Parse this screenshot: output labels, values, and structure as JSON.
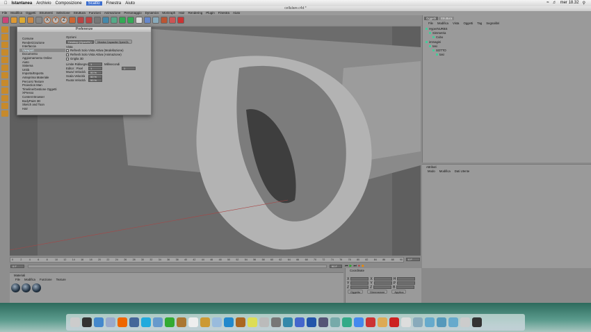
{
  "macmenu": {
    "apple": "apple-icon",
    "items": [
      "Istantanea",
      "Archivio",
      "Composizione",
      "Scatto",
      "Finestra",
      "Aiuto"
    ],
    "selected": "Scatto",
    "clock": "mer 18.32"
  },
  "window": {
    "title": "cellulare.c4d *"
  },
  "app_menu": [
    "File",
    "Modifica",
    "Oggetti",
    "Strumenti",
    "Selezione",
    "Struttura",
    "Funzioni",
    "Animazione",
    "Personaggio",
    "Dynamics",
    "MoGraph",
    "Hair",
    "Rendering",
    "Plugin",
    "Finestra",
    "Aiuto"
  ],
  "toolbar": {
    "axis_labels": [
      "X",
      "Y",
      "Z"
    ]
  },
  "prefs": {
    "title": "Preferenze",
    "sidebar": [
      "Comune",
      "Renderizzazione",
      "Interfaccia",
      "Viewport",
      "Documento",
      "Aggiornamento Online",
      "Aiuto",
      "Sistema",
      "Unità",
      "Importa/Esporta",
      "Anteprima Materiale",
      "Percorsi Texture",
      "Proiection Man",
      "Timeline/Gestione Oggetti",
      "XPresso",
      "Content Browser",
      "BodyPaint 3D",
      "Sketch and Toon",
      "Hair"
    ],
    "selected": "Viewport",
    "opzioni_label": "Opzioni",
    "display_select": "Desktop (OpenGL)",
    "opengl_button": "Mostra Capacità OpenGL",
    "vista_label": "Vista",
    "checks": [
      "Refresh Solo Vista Attiva (Modellazione)",
      "Refresh Solo Vista Attiva (Animazione)",
      "Griglia 3D"
    ],
    "fields": [
      {
        "label": "Limite Ridisegno",
        "value": "1",
        "unit": "Millisecondi"
      },
      {
        "label": "Editor : Pixel",
        "value": "1",
        "value2": "1"
      },
      {
        "label": "Muovi Velocità",
        "value": "50 %"
      },
      {
        "label": "Scala Velocità",
        "value": "50 %"
      },
      {
        "label": "Ruota Velocità",
        "value": "50 %"
      }
    ]
  },
  "objects": {
    "tabs": [
      "Oggetti",
      "Struttura"
    ],
    "menu": [
      "File",
      "Modifica",
      "Vista",
      "Oggetti",
      "Tag",
      "Segnalibri"
    ],
    "items": [
      {
        "name": "HyperNURBS",
        "depth": 0
      },
      {
        "name": "Simmetria",
        "depth": 1
      },
      {
        "name": "Cubo",
        "depth": 2
      },
      {
        "name": "immagini",
        "depth": 0
      },
      {
        "name": "tasi",
        "depth": 1
      },
      {
        "name": "SOTTO",
        "depth": 2
      },
      {
        "name": "tasi",
        "depth": 3
      }
    ]
  },
  "attributes": {
    "title": "Attributi",
    "menu": [
      "Modo",
      "Modifica",
      "Dati Utente"
    ]
  },
  "timeline": {
    "ticks": [
      "0",
      "2",
      "4",
      "6",
      "8",
      "10",
      "12",
      "14",
      "16",
      "18",
      "20",
      "22",
      "24",
      "26",
      "28",
      "30",
      "32",
      "34",
      "36",
      "38",
      "40",
      "42",
      "44",
      "46",
      "48",
      "50",
      "52",
      "54",
      "56",
      "58",
      "60",
      "62",
      "64",
      "66",
      "68",
      "70",
      "72",
      "74",
      "76",
      "78",
      "80",
      "82",
      "84",
      "86",
      "88",
      "90"
    ],
    "current": "0 F",
    "start": "0 F",
    "end": "90 F"
  },
  "materials": {
    "title": "Materiali",
    "menu": [
      "File",
      "Modifica",
      "Funzione",
      "Texture"
    ],
    "count": 3
  },
  "coords": {
    "title": "Coordinate",
    "axes": [
      "X",
      "Y",
      "Z"
    ],
    "rot_axes": [
      "H",
      "P",
      "B"
    ],
    "mode_select": "Oggetto",
    "size_select": "Dimensione",
    "apply": "Applica"
  },
  "colors": {
    "accent": "#3d6fcf",
    "panel": "#9a9a9a",
    "viewport": "#6f6f6f"
  }
}
